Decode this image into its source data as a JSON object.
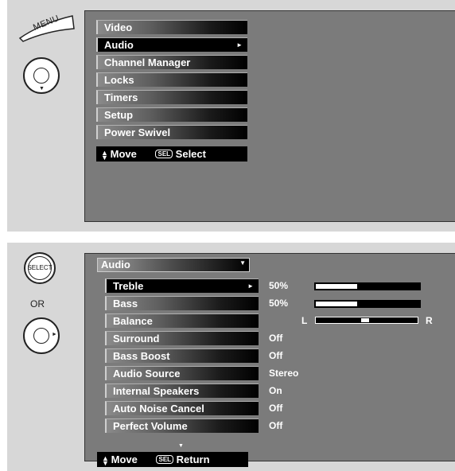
{
  "panel1": {
    "remote_label": "MENU",
    "menu_items": [
      {
        "label": "Video",
        "selected": false
      },
      {
        "label": "Audio",
        "selected": true,
        "arrow": "►"
      },
      {
        "label": "Channel Manager",
        "selected": false
      },
      {
        "label": "Locks",
        "selected": false
      },
      {
        "label": "Timers",
        "selected": false
      },
      {
        "label": "Setup",
        "selected": false
      },
      {
        "label": "Power Swivel",
        "selected": false
      }
    ],
    "footer": {
      "updown": "▲▼",
      "move": "Move",
      "sel": "SEL",
      "action": "Select"
    }
  },
  "panel2": {
    "select_button_label": "SELECT",
    "or_label": "OR",
    "header": {
      "label": "Audio",
      "arrow": "▼"
    },
    "items": [
      {
        "label": "Treble",
        "value": "50%",
        "selected": true,
        "arrow": "►",
        "level": 0.4
      },
      {
        "label": "Bass",
        "value": "50%",
        "selected": false,
        "level": 0.4
      },
      {
        "label": "Balance",
        "value": "",
        "selected": false,
        "balance_left": "L",
        "balance_right": "R",
        "balance_level": 0.5
      },
      {
        "label": "Surround",
        "value": "Off",
        "selected": false
      },
      {
        "label": "Bass Boost",
        "value": "Off",
        "selected": false
      },
      {
        "label": "Audio Source",
        "value": "Stereo",
        "selected": false
      },
      {
        "label": "Internal Speakers",
        "value": "On",
        "selected": false
      },
      {
        "label": "Auto Noise Cancel",
        "value": "Off",
        "selected": false
      },
      {
        "label": "Perfect Volume",
        "value": "Off",
        "selected": false
      }
    ],
    "scroll_indicator": "▼",
    "footer": {
      "updown": "▲▼",
      "move": "Move",
      "sel": "SEL",
      "action": "Return"
    }
  }
}
